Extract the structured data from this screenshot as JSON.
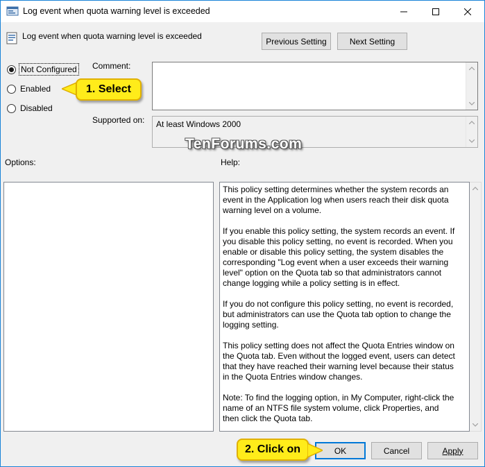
{
  "window": {
    "title": "Log event when quota warning level is exceeded",
    "accent_color": "#1883d7"
  },
  "header": {
    "policy_title": "Log event when quota warning level is exceeded",
    "previous_label": "Previous Setting",
    "next_label": "Next Setting"
  },
  "state": {
    "options": [
      {
        "label": "Not Configured",
        "selected": true
      },
      {
        "label": "Enabled",
        "selected": false
      },
      {
        "label": "Disabled",
        "selected": false
      }
    ]
  },
  "fields": {
    "comment_label": "Comment:",
    "comment_value": "",
    "supported_label": "Supported on:",
    "supported_value": "At least Windows 2000"
  },
  "panels": {
    "options_label": "Options:",
    "help_label": "Help:",
    "help_paragraphs": [
      "This policy setting determines whether the system records an event in the Application log when users reach their disk quota warning level on a volume.",
      "If you enable this policy setting, the system records an event. If you disable this policy setting, no event is recorded. When you enable or disable this policy setting, the system disables the corresponding \"Log event when a user exceeds their warning level\" option on the Quota tab so that administrators cannot change logging while a policy setting is in effect.",
      "If you do not configure this policy setting, no event is recorded, but administrators can use the Quota tab option to change the logging setting.",
      "This policy setting does not affect the Quota Entries window on the Quota tab. Even without the logged event, users can detect that they have reached their warning level because their status in the Quota Entries window changes.",
      "Note: To find the logging option, in My Computer, right-click the name of an NTFS file system volume, click Properties, and then click the Quota tab."
    ]
  },
  "footer": {
    "ok_label": "OK",
    "cancel_label": "Cancel",
    "apply_label": "Apply"
  },
  "annotations": {
    "callout_1": "1. Select",
    "callout_2": "2. Click on",
    "watermark": "TenForums.com",
    "callout_color": "#ffec1a"
  },
  "icons": {
    "app": "policy-app-icon",
    "header": "policy-setting-icon",
    "minimize": "minimize-icon",
    "maximize": "maximize-icon",
    "close": "close-icon"
  }
}
